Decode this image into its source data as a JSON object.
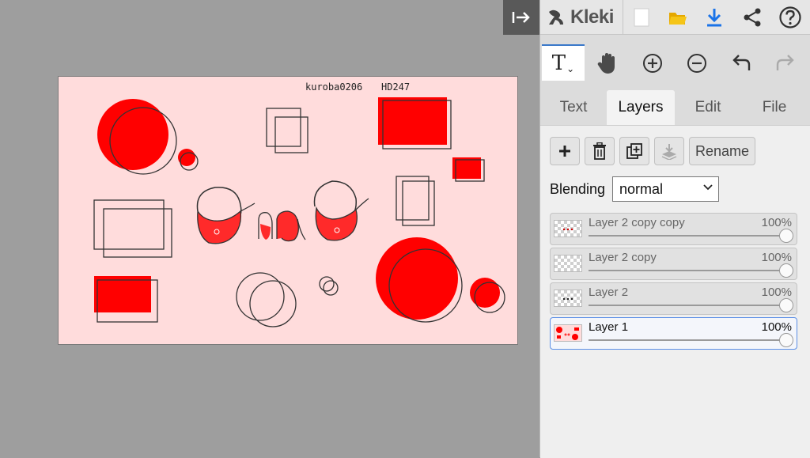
{
  "app": {
    "name": "Kleki"
  },
  "toolbar": {
    "collapse_icon": "collapse-right-icon",
    "new_icon": "new-document-icon",
    "open_icon": "folder-icon",
    "save_icon": "download-icon",
    "share_icon": "share-icon",
    "help_icon": "help-icon"
  },
  "tools": {
    "active_tool": "T",
    "hand_icon": "hand-icon",
    "zoom_in_icon": "zoom-in-icon",
    "zoom_out_icon": "zoom-out-icon",
    "undo_icon": "undo-icon",
    "redo_icon": "redo-icon"
  },
  "tabs": [
    {
      "label": "Text"
    },
    {
      "label": "Layers",
      "active": true
    },
    {
      "label": "Edit"
    },
    {
      "label": "File"
    }
  ],
  "layers_panel": {
    "add_icon": "plus-icon",
    "delete_icon": "trash-icon",
    "duplicate_icon": "duplicate-icon",
    "merge_icon": "merge-down-icon",
    "rename_label": "Rename",
    "blending_label": "Blending",
    "blending_value": "normal",
    "layers": [
      {
        "name": "Layer 2 copy copy",
        "opacity": "100%"
      },
      {
        "name": "Layer 2 copy",
        "opacity": "100%"
      },
      {
        "name": "Layer 2",
        "opacity": "100%"
      },
      {
        "name": "Layer 1",
        "opacity": "100%",
        "active": true
      }
    ]
  },
  "canvas": {
    "signature_left": "kuroba0206",
    "signature_right": "HD247",
    "background_color": "#ffdcdc",
    "ink_color": "#ff0000"
  },
  "colors": {
    "accent": "#3a78c9",
    "brand_folder": "#f5c518",
    "download_blue": "#1a73e8"
  }
}
